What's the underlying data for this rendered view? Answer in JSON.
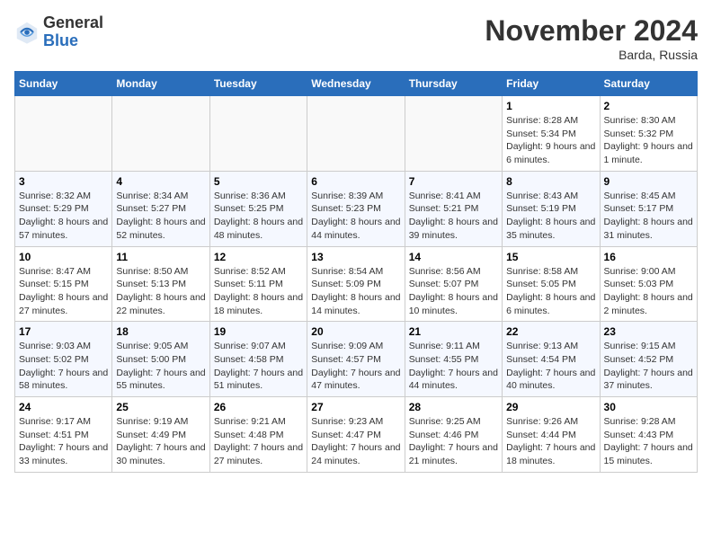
{
  "header": {
    "logo_general": "General",
    "logo_blue": "Blue",
    "month_title": "November 2024",
    "location": "Barda, Russia"
  },
  "weekdays": [
    "Sunday",
    "Monday",
    "Tuesday",
    "Wednesday",
    "Thursday",
    "Friday",
    "Saturday"
  ],
  "weeks": [
    [
      {
        "day": "",
        "empty": true
      },
      {
        "day": "",
        "empty": true
      },
      {
        "day": "",
        "empty": true
      },
      {
        "day": "",
        "empty": true
      },
      {
        "day": "",
        "empty": true
      },
      {
        "day": "1",
        "sunrise": "Sunrise: 8:28 AM",
        "sunset": "Sunset: 5:34 PM",
        "daylight": "Daylight: 9 hours and 6 minutes."
      },
      {
        "day": "2",
        "sunrise": "Sunrise: 8:30 AM",
        "sunset": "Sunset: 5:32 PM",
        "daylight": "Daylight: 9 hours and 1 minute."
      }
    ],
    [
      {
        "day": "3",
        "sunrise": "Sunrise: 8:32 AM",
        "sunset": "Sunset: 5:29 PM",
        "daylight": "Daylight: 8 hours and 57 minutes."
      },
      {
        "day": "4",
        "sunrise": "Sunrise: 8:34 AM",
        "sunset": "Sunset: 5:27 PM",
        "daylight": "Daylight: 8 hours and 52 minutes."
      },
      {
        "day": "5",
        "sunrise": "Sunrise: 8:36 AM",
        "sunset": "Sunset: 5:25 PM",
        "daylight": "Daylight: 8 hours and 48 minutes."
      },
      {
        "day": "6",
        "sunrise": "Sunrise: 8:39 AM",
        "sunset": "Sunset: 5:23 PM",
        "daylight": "Daylight: 8 hours and 44 minutes."
      },
      {
        "day": "7",
        "sunrise": "Sunrise: 8:41 AM",
        "sunset": "Sunset: 5:21 PM",
        "daylight": "Daylight: 8 hours and 39 minutes."
      },
      {
        "day": "8",
        "sunrise": "Sunrise: 8:43 AM",
        "sunset": "Sunset: 5:19 PM",
        "daylight": "Daylight: 8 hours and 35 minutes."
      },
      {
        "day": "9",
        "sunrise": "Sunrise: 8:45 AM",
        "sunset": "Sunset: 5:17 PM",
        "daylight": "Daylight: 8 hours and 31 minutes."
      }
    ],
    [
      {
        "day": "10",
        "sunrise": "Sunrise: 8:47 AM",
        "sunset": "Sunset: 5:15 PM",
        "daylight": "Daylight: 8 hours and 27 minutes."
      },
      {
        "day": "11",
        "sunrise": "Sunrise: 8:50 AM",
        "sunset": "Sunset: 5:13 PM",
        "daylight": "Daylight: 8 hours and 22 minutes."
      },
      {
        "day": "12",
        "sunrise": "Sunrise: 8:52 AM",
        "sunset": "Sunset: 5:11 PM",
        "daylight": "Daylight: 8 hours and 18 minutes."
      },
      {
        "day": "13",
        "sunrise": "Sunrise: 8:54 AM",
        "sunset": "Sunset: 5:09 PM",
        "daylight": "Daylight: 8 hours and 14 minutes."
      },
      {
        "day": "14",
        "sunrise": "Sunrise: 8:56 AM",
        "sunset": "Sunset: 5:07 PM",
        "daylight": "Daylight: 8 hours and 10 minutes."
      },
      {
        "day": "15",
        "sunrise": "Sunrise: 8:58 AM",
        "sunset": "Sunset: 5:05 PM",
        "daylight": "Daylight: 8 hours and 6 minutes."
      },
      {
        "day": "16",
        "sunrise": "Sunrise: 9:00 AM",
        "sunset": "Sunset: 5:03 PM",
        "daylight": "Daylight: 8 hours and 2 minutes."
      }
    ],
    [
      {
        "day": "17",
        "sunrise": "Sunrise: 9:03 AM",
        "sunset": "Sunset: 5:02 PM",
        "daylight": "Daylight: 7 hours and 58 minutes."
      },
      {
        "day": "18",
        "sunrise": "Sunrise: 9:05 AM",
        "sunset": "Sunset: 5:00 PM",
        "daylight": "Daylight: 7 hours and 55 minutes."
      },
      {
        "day": "19",
        "sunrise": "Sunrise: 9:07 AM",
        "sunset": "Sunset: 4:58 PM",
        "daylight": "Daylight: 7 hours and 51 minutes."
      },
      {
        "day": "20",
        "sunrise": "Sunrise: 9:09 AM",
        "sunset": "Sunset: 4:57 PM",
        "daylight": "Daylight: 7 hours and 47 minutes."
      },
      {
        "day": "21",
        "sunrise": "Sunrise: 9:11 AM",
        "sunset": "Sunset: 4:55 PM",
        "daylight": "Daylight: 7 hours and 44 minutes."
      },
      {
        "day": "22",
        "sunrise": "Sunrise: 9:13 AM",
        "sunset": "Sunset: 4:54 PM",
        "daylight": "Daylight: 7 hours and 40 minutes."
      },
      {
        "day": "23",
        "sunrise": "Sunrise: 9:15 AM",
        "sunset": "Sunset: 4:52 PM",
        "daylight": "Daylight: 7 hours and 37 minutes."
      }
    ],
    [
      {
        "day": "24",
        "sunrise": "Sunrise: 9:17 AM",
        "sunset": "Sunset: 4:51 PM",
        "daylight": "Daylight: 7 hours and 33 minutes."
      },
      {
        "day": "25",
        "sunrise": "Sunrise: 9:19 AM",
        "sunset": "Sunset: 4:49 PM",
        "daylight": "Daylight: 7 hours and 30 minutes."
      },
      {
        "day": "26",
        "sunrise": "Sunrise: 9:21 AM",
        "sunset": "Sunset: 4:48 PM",
        "daylight": "Daylight: 7 hours and 27 minutes."
      },
      {
        "day": "27",
        "sunrise": "Sunrise: 9:23 AM",
        "sunset": "Sunset: 4:47 PM",
        "daylight": "Daylight: 7 hours and 24 minutes."
      },
      {
        "day": "28",
        "sunrise": "Sunrise: 9:25 AM",
        "sunset": "Sunset: 4:46 PM",
        "daylight": "Daylight: 7 hours and 21 minutes."
      },
      {
        "day": "29",
        "sunrise": "Sunrise: 9:26 AM",
        "sunset": "Sunset: 4:44 PM",
        "daylight": "Daylight: 7 hours and 18 minutes."
      },
      {
        "day": "30",
        "sunrise": "Sunrise: 9:28 AM",
        "sunset": "Sunset: 4:43 PM",
        "daylight": "Daylight: 7 hours and 15 minutes."
      }
    ]
  ]
}
